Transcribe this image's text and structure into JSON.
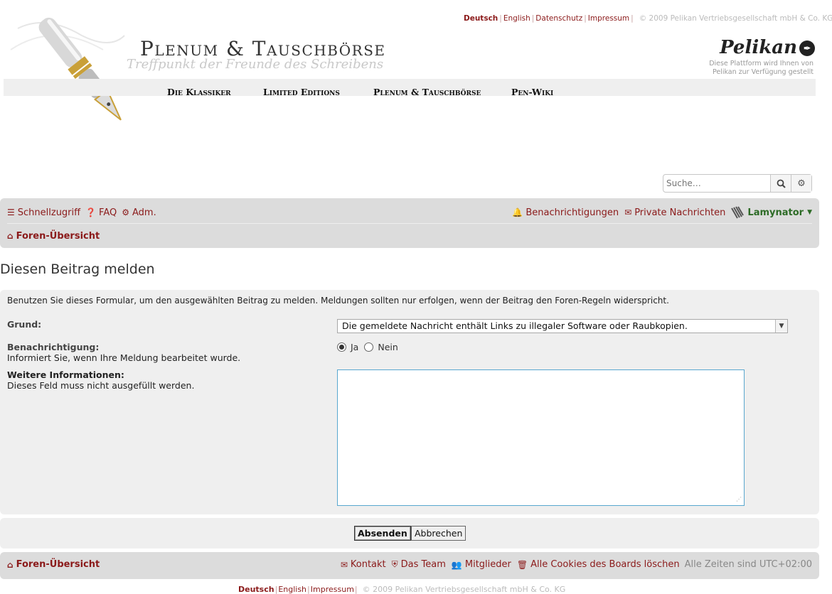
{
  "header": {
    "languages": [
      "Deutsch",
      "English"
    ],
    "legal_links": [
      "Datenschutz",
      "Impressum"
    ],
    "copyright": "© 2009 Pelikan Vertriebsgesellschaft mbH & Co. KG",
    "site_title": "Plenum & Tauschbörse",
    "tagline": "Treffpunkt der Freunde des Schreibens",
    "logo": "Pelikan",
    "logo_sub_line1": "Diese Plattform wird Ihnen von",
    "logo_sub_line2": "Pelikan zur Verfügung gestellt",
    "main_nav": [
      "Die Klassiker",
      "Limited Editions",
      "Plenum & Tauschbörse",
      "Pen-Wiki"
    ]
  },
  "search": {
    "placeholder": "Suche…"
  },
  "navbar": {
    "quick_links": "Schnellzugriff",
    "faq": "FAQ",
    "admin": "Adm.",
    "notifications": "Benachrichtigungen",
    "private_messages": "Private Nachrichten",
    "username": "Lamynator",
    "breadcrumb": "Foren-Übersicht"
  },
  "page": {
    "title": "Diesen Beitrag melden",
    "intro": "Benutzen Sie dieses Formular, um den ausgewählten Beitrag zu melden. Meldungen sollten nur erfolgen, wenn der Beitrag den Foren-Regeln widerspricht.",
    "reason_label": "Grund:",
    "reason_selected": "Die gemeldete Nachricht enthält Links zu illegaler Software oder Raubkopien.",
    "notify_label": "Benachrichtigung:",
    "notify_desc": "Informiert Sie, wenn Ihre Meldung bearbeitet wurde.",
    "notify_yes": "Ja",
    "notify_no": "Nein",
    "notify_value": "Ja",
    "more_info_label": "Weitere Informationen:",
    "more_info_desc": "Dieses Feld muss nicht ausgefüllt werden.",
    "more_info_value": "",
    "submit": "Absenden",
    "cancel": "Abbrechen"
  },
  "footer": {
    "breadcrumb": "Foren-Übersicht",
    "contact": "Kontakt",
    "team": "Das Team",
    "members": "Mitglieder",
    "delete_cookies": "Alle Cookies des Boards löschen",
    "timezone": "Alle Zeiten sind UTC+02:00",
    "bottom_languages": [
      "Deutsch",
      "English"
    ],
    "bottom_legal": "Impressum",
    "copyright": "© 2009 Pelikan Vertriebsgesellschaft mbH & Co. KG"
  },
  "colors": {
    "link": "#8b1a1a",
    "user": "#2d6b26",
    "navbar_bg": "#dcdcdc",
    "panel_bg": "#efefef",
    "textarea_border": "#58a7cf"
  }
}
